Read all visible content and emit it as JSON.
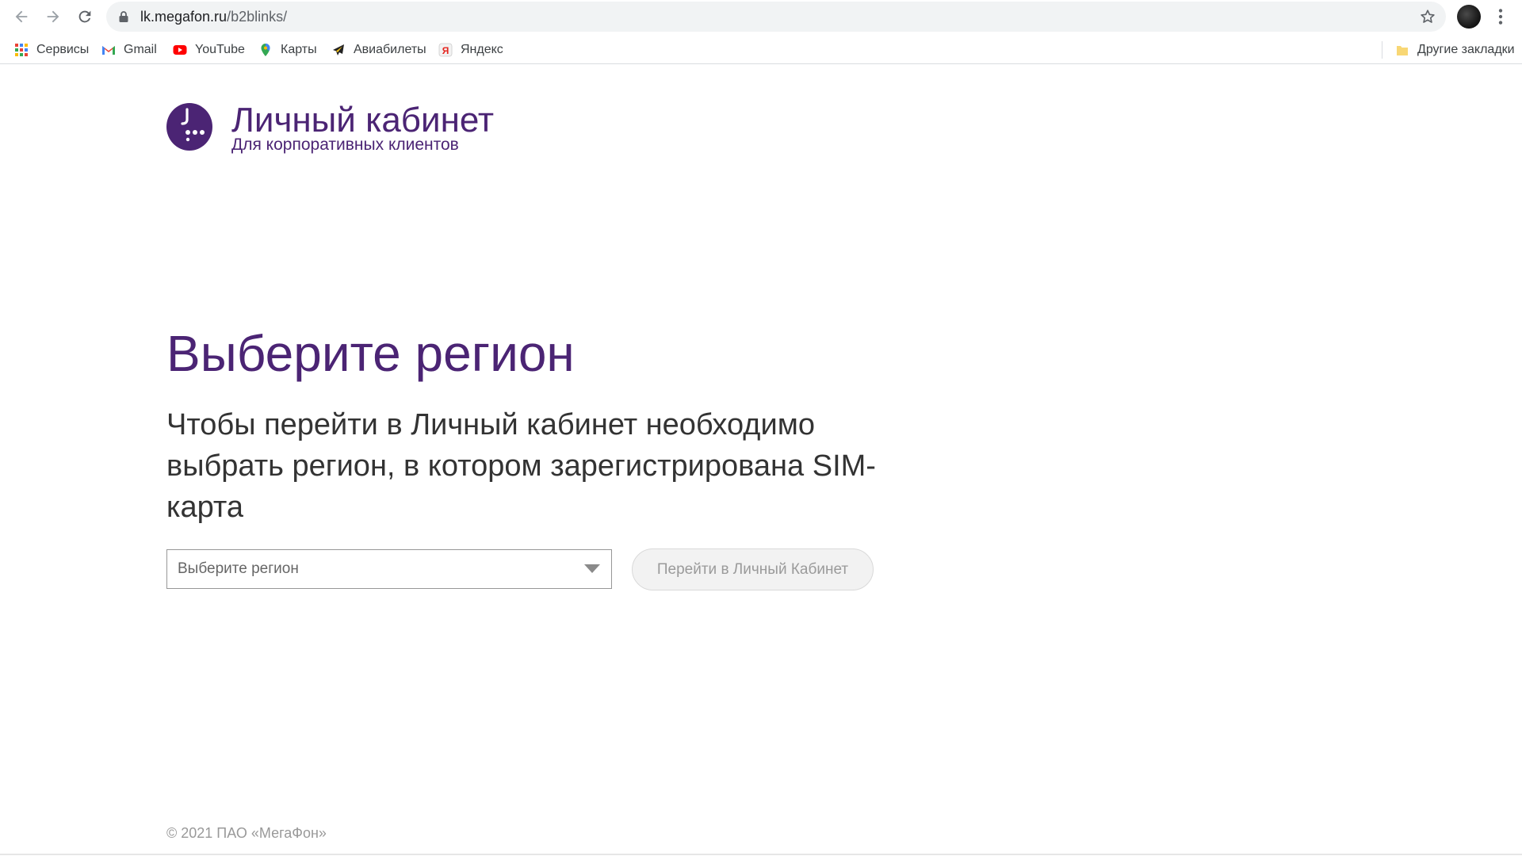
{
  "browser": {
    "url_host": "lk.megafon.ru",
    "url_path": "/b2blinks/",
    "bookmarks": [
      {
        "label": "Сервисы",
        "icon": "apps-grid-icon"
      },
      {
        "label": "Gmail",
        "icon": "gmail-icon"
      },
      {
        "label": "YouTube",
        "icon": "youtube-icon"
      },
      {
        "label": "Карты",
        "icon": "maps-pin-icon"
      },
      {
        "label": "Авиабилеты",
        "icon": "airplane-icon"
      },
      {
        "label": "Яндекс",
        "icon": "yandex-icon"
      }
    ],
    "other_bookmarks": "Другие закладки"
  },
  "header": {
    "logo_title": "Личный кабинет",
    "logo_subtitle": "Для корпоративных клиентов"
  },
  "main": {
    "title": "Выберите регион",
    "lead": "Чтобы перейти в Личный кабинет необходимо выбрать регион, в котором зарегистрирована SIM-карта",
    "region_select": {
      "placeholder": "Выберите регион",
      "value": ""
    },
    "go_button": "Перейти в Личный Кабинет"
  },
  "footer": {
    "copyright": "© 2021 ПАО «МегаФон»"
  },
  "colors": {
    "brand_purple": "#4b2474",
    "button_bg": "#f2f2f2",
    "text_dark": "#333333"
  }
}
